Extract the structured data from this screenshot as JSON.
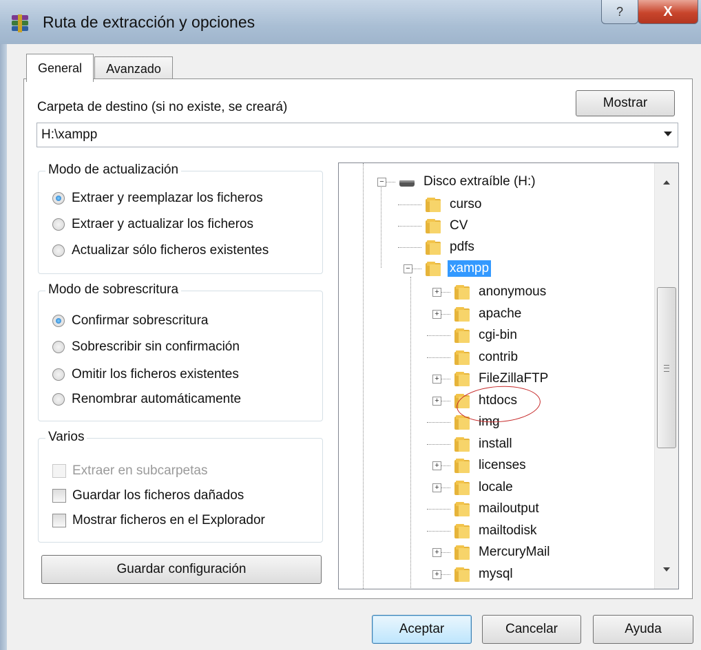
{
  "window": {
    "title": "Ruta de extracción y opciones",
    "help_glyph": "?",
    "close_glyph": "X"
  },
  "tabs": [
    {
      "label": "General",
      "active": true
    },
    {
      "label": "Avanzado",
      "active": false
    }
  ],
  "destination": {
    "label": "Carpeta de destino (si no existe, se creará)",
    "value": "H:\\xampp",
    "show_button": "Mostrar"
  },
  "update_mode": {
    "legend": "Modo de actualización",
    "options": [
      {
        "label": "Extraer y reemplazar los ficheros",
        "selected": true
      },
      {
        "label": "Extraer y actualizar los ficheros",
        "selected": false
      },
      {
        "label": "Actualizar sólo ficheros existentes",
        "selected": false
      }
    ]
  },
  "overwrite_mode": {
    "legend": "Modo de sobrescritura",
    "options": [
      {
        "label": "Confirmar sobrescritura",
        "selected": true
      },
      {
        "label": "Sobrescribir sin confirmación",
        "selected": false
      },
      {
        "label": "Omitir los ficheros existentes",
        "selected": false
      },
      {
        "label": "Renombrar automáticamente",
        "selected": false
      }
    ]
  },
  "misc": {
    "legend": "Varios",
    "options": [
      {
        "label": "Extraer en subcarpetas",
        "checked": false,
        "disabled": true
      },
      {
        "label": "Guardar los ficheros dañados",
        "checked": false,
        "disabled": false
      },
      {
        "label": "Mostrar ficheros en el Explorador",
        "checked": false,
        "disabled": false
      }
    ]
  },
  "save_settings_button": "Guardar configuración",
  "tree": {
    "drive": "Disco extraíble (H:)",
    "drive_folders": [
      "curso",
      "CV",
      "pdfs"
    ],
    "open_folder": "xampp",
    "children": [
      {
        "name": "anonymous",
        "expandable": true
      },
      {
        "name": "apache",
        "expandable": true
      },
      {
        "name": "cgi-bin",
        "expandable": false
      },
      {
        "name": "contrib",
        "expandable": false
      },
      {
        "name": "FileZillaFTP",
        "expandable": true
      },
      {
        "name": "htdocs",
        "expandable": true
      },
      {
        "name": "img",
        "expandable": false
      },
      {
        "name": "install",
        "expandable": false
      },
      {
        "name": "licenses",
        "expandable": true
      },
      {
        "name": "locale",
        "expandable": true
      },
      {
        "name": "mailoutput",
        "expandable": false
      },
      {
        "name": "mailtodisk",
        "expandable": false
      },
      {
        "name": "MercuryMail",
        "expandable": true
      },
      {
        "name": "mysql",
        "expandable": true
      }
    ]
  },
  "footer": {
    "ok": "Aceptar",
    "cancel": "Cancelar",
    "help": "Ayuda"
  },
  "colors": {
    "selection": "#3399ff",
    "annotation": "#c62828",
    "folder": "#f3c44b"
  }
}
